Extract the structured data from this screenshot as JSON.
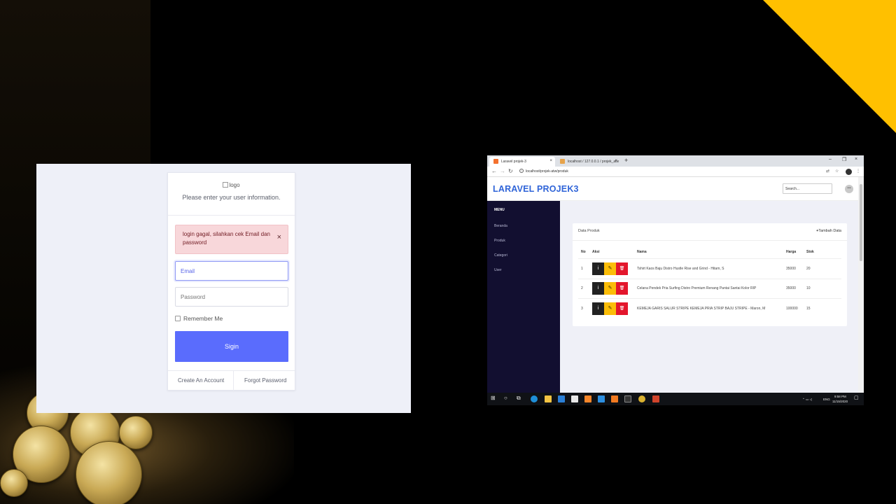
{
  "login": {
    "logo_alt": "logo",
    "subtitle": "Please enter your user information.",
    "alert_text": "login gagal, silahkan cek Email dan password",
    "alert_close": "×",
    "email_placeholder": "Email",
    "password_placeholder": "Password",
    "remember_label": "Remember Me",
    "signin_label": "Sigin",
    "create_account": "Create An Account",
    "forgot_password": "Forgot Password",
    "accent_color": "#5a6cfd"
  },
  "browser": {
    "tabs": [
      {
        "label": "Laravel projek-3",
        "active": true
      },
      {
        "label": "localhost / 127.0.0.1 / projek_atw",
        "active": false
      }
    ],
    "tab_close": "×",
    "new_tab": "+",
    "url": "localhost/projek-atw/produk",
    "window_controls": [
      "–",
      "❐",
      "×"
    ]
  },
  "app": {
    "brand": "LARAVEL PROJEK3",
    "brand_color": "#2f64d8",
    "search_placeholder": "Search...",
    "menu_title": "MENU",
    "menu_items": [
      "Beranda",
      "Produk",
      "Categori",
      "User"
    ],
    "panel_title": "Data Produk",
    "add_button": "Tambah Data",
    "add_icon": "+",
    "columns": {
      "no": "No",
      "aksi": "Aksi",
      "nama": "Nama",
      "harga": "Harga",
      "stok": "Stok"
    },
    "rows": [
      {
        "no": "1",
        "nama": "Tshirt Kaos Baju Distro Hustle Rise and Grind - Hitam, S",
        "harga": "35000",
        "stok": "20"
      },
      {
        "no": "2",
        "nama": "Celana Pendek Pria Surfing Distro Premium Renang Pantai Santai Kolor RIP",
        "harga": "35000",
        "stok": "10"
      },
      {
        "no": "3",
        "nama": "KEMEJA GARIS SALUR STRIPE KEMEJA PRIA STRIP BAJU STRIPE - Maron, M",
        "harga": "100000",
        "stok": "15"
      }
    ],
    "action_icons": {
      "info": "i",
      "edit": "✎",
      "delete": "🗑"
    }
  },
  "taskbar": {
    "time": "9:58 PM",
    "date": "11/15/2020",
    "lang": "ENG"
  }
}
